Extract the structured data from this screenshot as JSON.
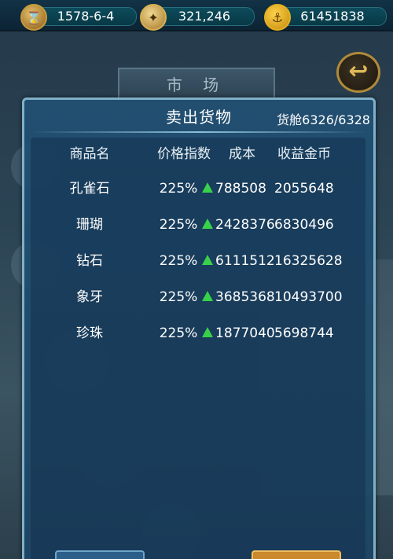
{
  "topbar": {
    "date": "1578-6-4",
    "compass_value": "321,246",
    "gold_value": "61451838",
    "icons": [
      "hourglass-icon",
      "compass-icon",
      "anchor-coin-icon"
    ]
  },
  "market": {
    "title": "市 场"
  },
  "dialog": {
    "title": "卖出货物",
    "hold": "货舱6326/6328",
    "columns": [
      "商品名",
      "价格指数",
      "成本",
      "收益金币"
    ],
    "rows": [
      {
        "name": "孔雀石",
        "price": "225%",
        "cost": "788508",
        "profit": "2055648"
      },
      {
        "name": "珊瑚",
        "price": "225%",
        "cost": "2428376",
        "profit": "6830496"
      },
      {
        "name": "钻石",
        "price": "225%",
        "cost": "6111512",
        "profit": "16325628"
      },
      {
        "name": "象牙",
        "price": "225%",
        "cost": "3685368",
        "profit": "10493700"
      },
      {
        "name": "珍珠",
        "price": "225%",
        "cost": "1877040",
        "profit": "5698744"
      }
    ]
  },
  "colors": {
    "accent_up_arrow": "#38d24a",
    "dialog_border": "#7fb0c8",
    "panel_bg": "#1c4666"
  }
}
